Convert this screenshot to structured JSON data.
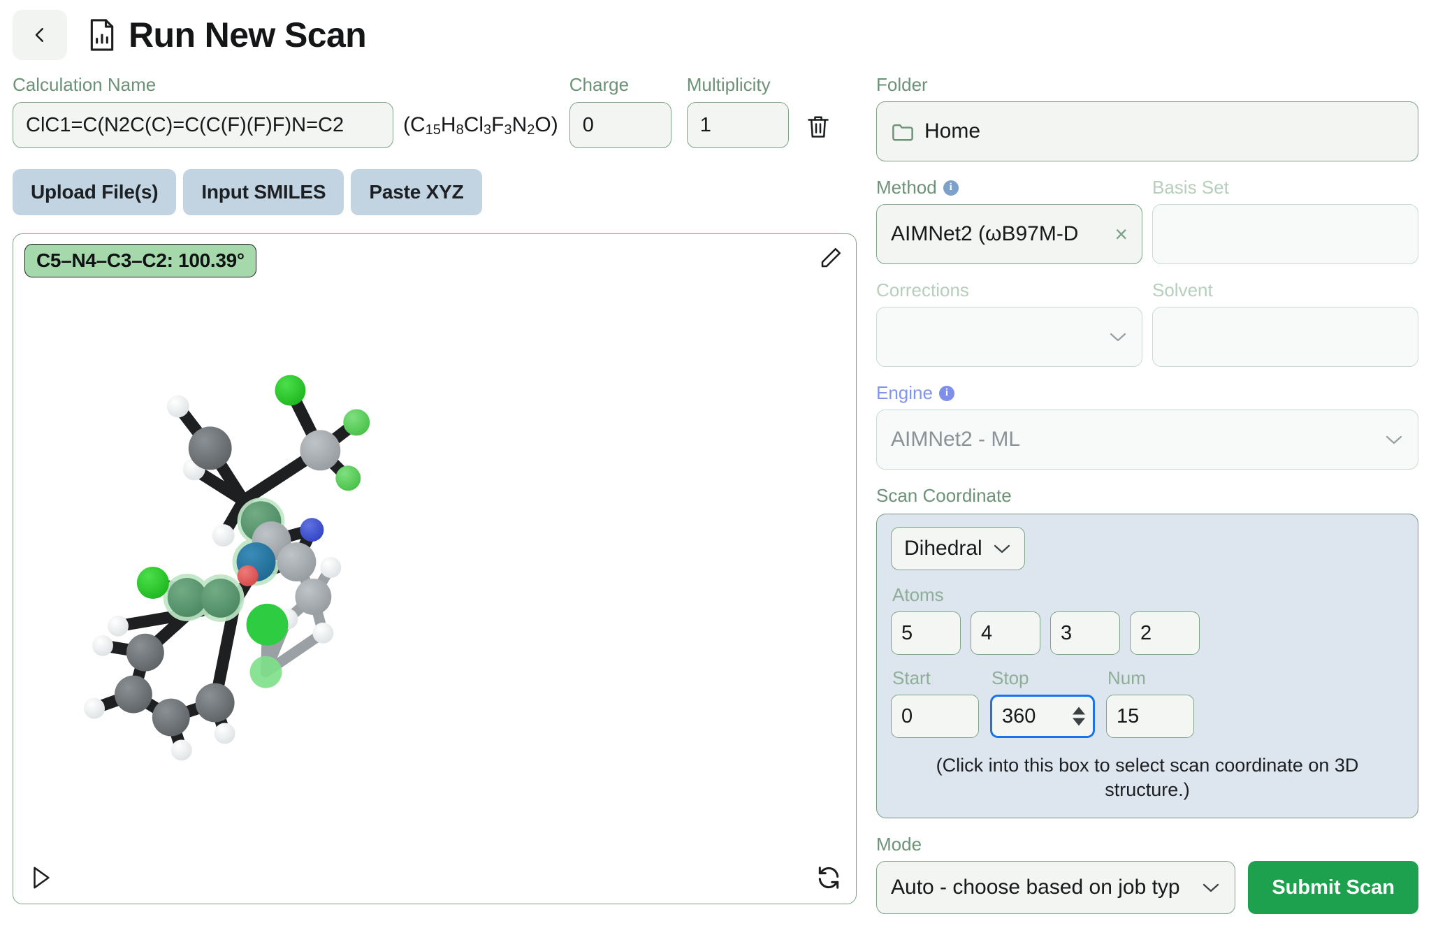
{
  "header": {
    "back_icon": "chevron-left-icon",
    "doc_icon": "document-chart-icon",
    "title": "Run New Scan"
  },
  "left": {
    "calculation_name": {
      "label": "Calculation Name",
      "value": "ClC1=C(N2C(C)=C(C(F)(F)F)N=C2",
      "formula_prefix": "(C",
      "formula": "(C15H8Cl3F3N2O)"
    },
    "charge": {
      "label": "Charge",
      "value": "0"
    },
    "multiplicity": {
      "label": "Multiplicity",
      "value": "1"
    },
    "delete_icon": "trash-icon",
    "buttons": [
      {
        "label": "Upload File(s)",
        "name": "upload-files-button"
      },
      {
        "label": "Input SMILES",
        "name": "input-smiles-button"
      },
      {
        "label": "Paste XYZ",
        "name": "paste-xyz-button"
      }
    ],
    "viewer": {
      "dihedral_badge": "C5–N4–C3–C2: 100.39°",
      "edit_icon": "pencil-icon",
      "play_icon": "play-icon",
      "refresh_icon": "refresh-icon"
    }
  },
  "right": {
    "folder": {
      "label": "Folder",
      "value": "Home",
      "icon": "folder-icon"
    },
    "method": {
      "label": "Method",
      "value": "AIMNet2 (ωB97M-D",
      "clear": "×",
      "info_icon": "info-icon"
    },
    "basis_set": {
      "label": "Basis Set",
      "value": ""
    },
    "corrections": {
      "label": "Corrections",
      "value": ""
    },
    "solvent": {
      "label": "Solvent",
      "value": ""
    },
    "engine": {
      "label": "Engine",
      "value": "AIMNet2 - ML",
      "info_icon": "info-icon"
    },
    "scan_coordinate": {
      "label": "Scan Coordinate",
      "type": "Dihedral",
      "atoms_label": "Atoms",
      "atoms": [
        "5",
        "4",
        "3",
        "2"
      ],
      "start_label": "Start",
      "stop_label": "Stop",
      "num_label": "Num",
      "start": "0",
      "stop": "360",
      "num": "15",
      "hint": "(Click into this box to select scan coordinate on 3D structure.)"
    },
    "mode": {
      "label": "Mode",
      "value": "Auto - choose based on job typ"
    },
    "submit": {
      "label": "Submit Scan"
    }
  },
  "colors": {
    "accent_green": "#6d9277",
    "submit_green": "#1ea14e",
    "badge_green": "#a5d8ab",
    "panel_blue": "#dde5ef",
    "button_blue": "#c2d3e2",
    "focus_blue": "#1a73e8",
    "engine_label_blue": "#8094ea"
  },
  "molecule": {
    "atom_colors": {
      "carbon": "#6f7376",
      "carbon_light": "#a8adb1",
      "hydrogen": "#f2f4f5",
      "nitrogen": "#4158d0",
      "chlorine": "#2ecc40",
      "fluorine": "#5fd35f",
      "oxygen": "#e06060",
      "highlight_carbon": "#5e9a73",
      "highlight_nitrogen": "#2b7ba5",
      "glow": "#b9e4bf"
    }
  }
}
